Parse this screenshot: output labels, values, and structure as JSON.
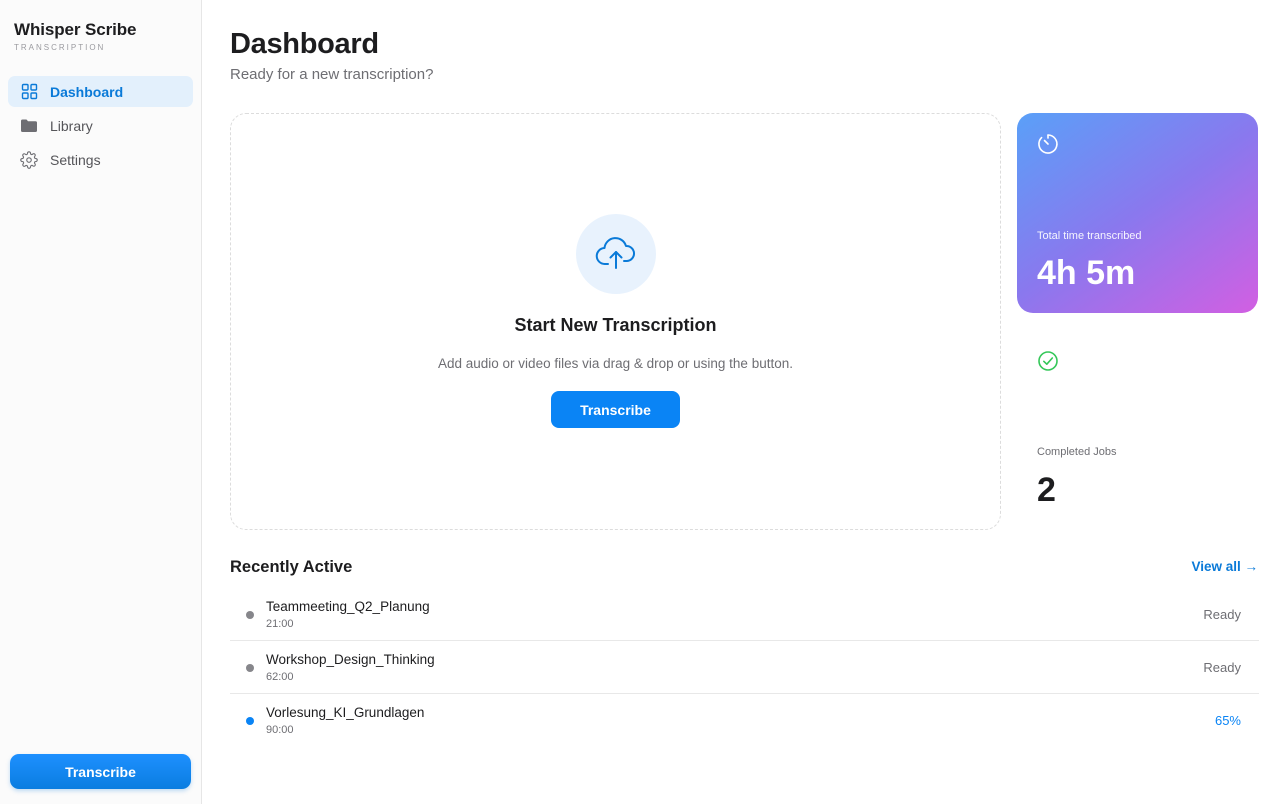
{
  "app": {
    "name": "Whisper Scribe",
    "subtitle": "TRANSCRIPTION"
  },
  "sidebar": {
    "items": [
      {
        "label": "Dashboard",
        "icon": "grid-icon",
        "active": true
      },
      {
        "label": "Library",
        "icon": "folder-icon",
        "active": false
      },
      {
        "label": "Settings",
        "icon": "gear-icon",
        "active": false
      }
    ],
    "button_label": "Transcribe"
  },
  "header": {
    "title": "Dashboard",
    "subtitle": "Ready for a new transcription?"
  },
  "dropzone": {
    "icon": "cloud-upload-icon",
    "title": "Start New Transcription",
    "text": "Add audio or video files via drag & drop or using the button.",
    "button_label": "Transcribe"
  },
  "stats": {
    "time": {
      "icon": "timer-icon",
      "label": "Total time transcribed",
      "value": "4h 5m"
    },
    "jobs": {
      "icon": "check-circle-icon",
      "label": "Completed Jobs",
      "value": "2"
    }
  },
  "recent": {
    "title": "Recently Active",
    "view_all": "View all →",
    "rows": [
      {
        "name": "Teammeeting_Q2_Planung",
        "duration": "21:00",
        "status": "Ready",
        "in_progress": false
      },
      {
        "name": "Workshop_Design_Thinking",
        "duration": "62:00",
        "status": "Ready",
        "in_progress": false
      },
      {
        "name": "Vorlesung_KI_Grundlagen",
        "duration": "90:00",
        "status": "65%",
        "in_progress": true
      }
    ]
  },
  "colors": {
    "accent": "#0a84f5",
    "active_nav_bg": "#e3f0fc",
    "gradient_start": "#5aa0f8",
    "gradient_end": "#d25fe2",
    "success": "#34c759"
  }
}
